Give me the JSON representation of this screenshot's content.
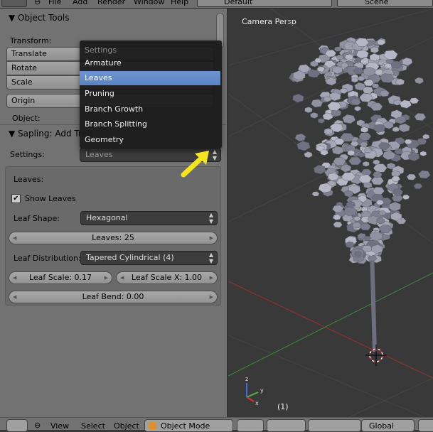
{
  "topbar": {
    "menus": [
      "File",
      "Add",
      "Render",
      "Window",
      "Help"
    ],
    "layout": "Default",
    "scene": "Scene"
  },
  "tools": {
    "title": "Object Tools",
    "transform_label": "Transform:",
    "translate": "Translate",
    "rotate": "Rotate",
    "scale": "Scale",
    "origin": "Origin",
    "object_label": "Object:"
  },
  "sapling": {
    "title": "Sapling: Add Tree",
    "settings_label": "Settings:",
    "settings_value": "Leaves",
    "leaves_label": "Leaves:",
    "show_leaves": "Show Leaves",
    "show_leaves_checked": true,
    "leaf_shape_label": "Leaf Shape:",
    "leaf_shape": "Hexagonal",
    "leaves_count": "Leaves: 25",
    "leaf_dist_label": "Leaf Distribution:",
    "leaf_dist": "Tapered Cylindrical (4)",
    "leaf_scale": "Leaf Scale: 0.17",
    "leaf_scale_x": "Leaf Scale X: 1.00",
    "leaf_bend": "Leaf Bend: 0.00"
  },
  "menu": {
    "title": "Settings",
    "items": [
      "Armature",
      "Leaves",
      "Pruning",
      "Branch Growth",
      "Branch Splitting",
      "Geometry"
    ],
    "active": "Leaves"
  },
  "viewport": {
    "label": "Camera Persp",
    "frame": "(1)"
  },
  "bottombar": {
    "menus": [
      "View",
      "Select",
      "Object"
    ],
    "mode": "Object Mode",
    "orientation": "Global"
  },
  "colors": {
    "highlight": "#5a83c3",
    "arrow": "#f5e51e"
  }
}
